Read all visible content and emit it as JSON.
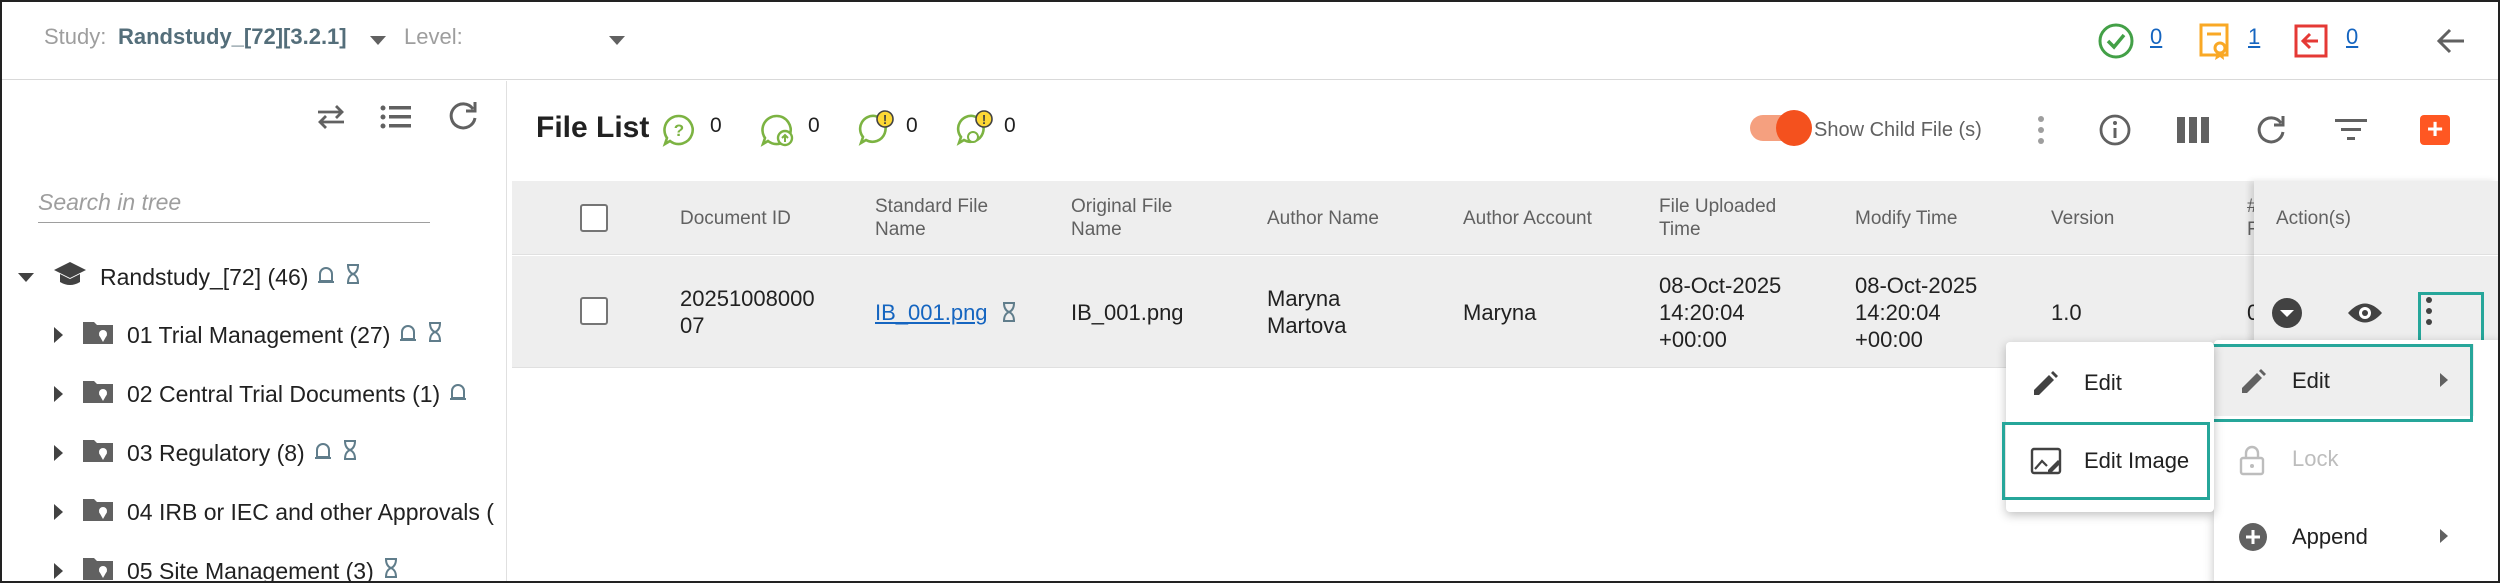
{
  "topbar": {
    "study_label": "Study:",
    "study_value": "Randstudy_[72][3.2.1]",
    "level_label": "Level:",
    "status_approved_count": "0",
    "status_signed_count": "1",
    "status_returned_count": "0",
    "colors": {
      "approved": "#43a047",
      "signed": "#f9a825",
      "returned": "#e53935"
    }
  },
  "tree": {
    "search_placeholder": "Search in tree",
    "root": {
      "label": "Randstudy_[72] (46)"
    },
    "items": [
      {
        "label": "01  Trial Management (27)"
      },
      {
        "label": "02  Central Trial Documents (1)"
      },
      {
        "label": "03  Regulatory (8)"
      },
      {
        "label": "04  IRB or IEC and other Approvals ("
      },
      {
        "label": "05  Site Management (3)"
      }
    ]
  },
  "file_list": {
    "title": "File List",
    "stats": [
      "0",
      "0",
      "0",
      "0"
    ],
    "show_child_label": "Show Child File (s)",
    "accent": "#ff5722"
  },
  "table": {
    "headers": {
      "document_id": "Document ID",
      "standard_file_name_1": "Standard File",
      "standard_file_name_2": "Name",
      "original_file_name_1": "Original File",
      "original_file_name_2": "Name",
      "author_name": "Author Name",
      "author_account": "Author Account",
      "file_uploaded_1": "File Uploaded",
      "file_uploaded_2": "Time",
      "modify_time": "Modify Time",
      "version": "Version",
      "hidden_col_1": "#",
      "hidden_col_2": "F",
      "actions": "Action(s)"
    },
    "row": {
      "document_id_1": "20251008000",
      "document_id_2": "07",
      "standard_file_name": "IB_001.png",
      "original_file_name": "IB_001.png",
      "author_name_1": "Maryna",
      "author_name_2": "Martova",
      "author_account": "Maryna",
      "uploaded_1": "08-Oct-2025",
      "uploaded_2": "14:20:04",
      "uploaded_3": "+00:00",
      "modified_1": "08-Oct-2025",
      "modified_2": "14:20:04",
      "modified_3": "+00:00",
      "version": "1.0",
      "hidden_val": "0"
    }
  },
  "context_menu": {
    "edit": "Edit",
    "lock": "Lock",
    "append": "Append"
  },
  "sub_menu": {
    "edit": "Edit",
    "edit_image": "Edit Image"
  },
  "highlight_color": "#26a69a"
}
